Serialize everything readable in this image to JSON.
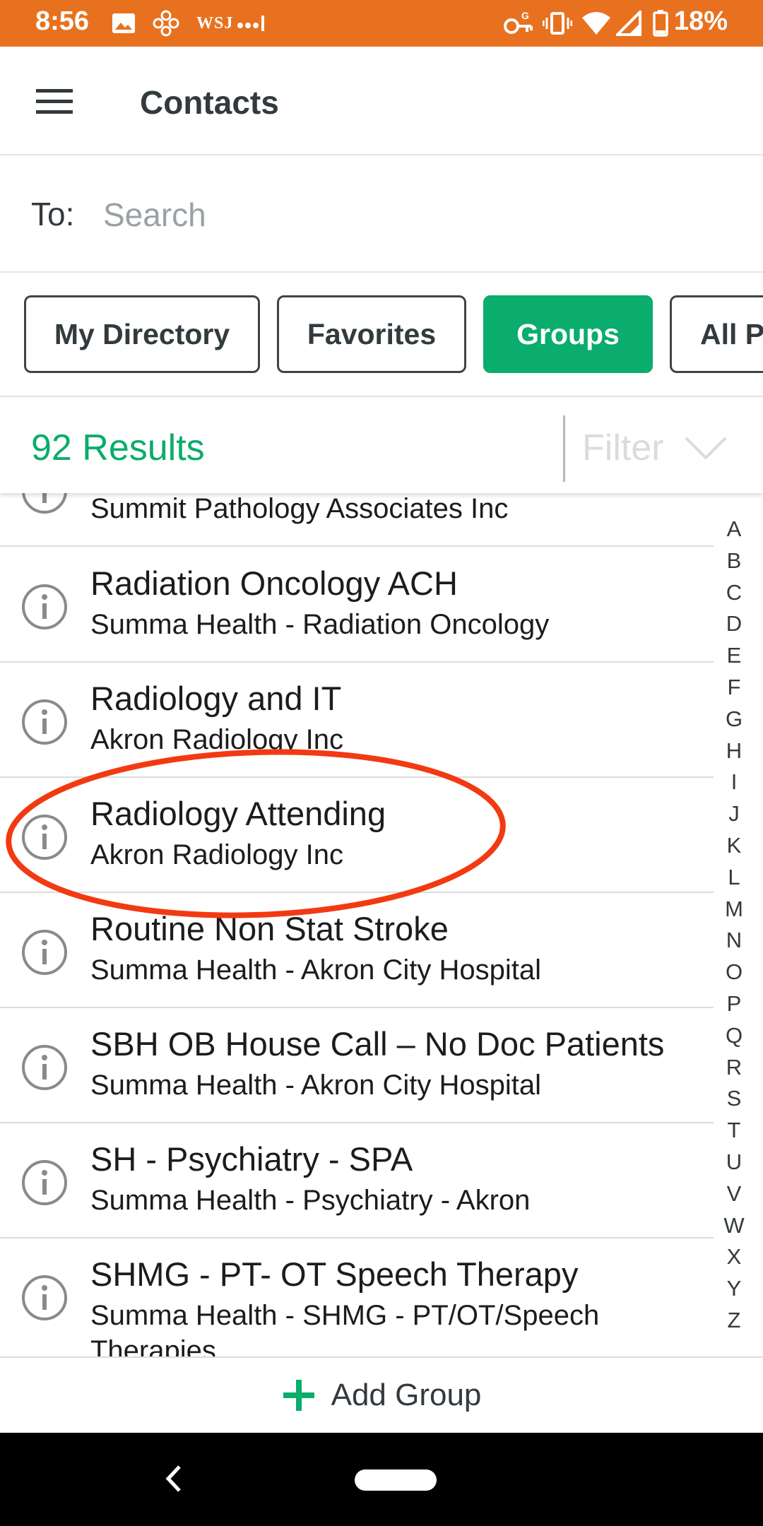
{
  "status_bar": {
    "time": "8:56",
    "wsj_label": "WSJ",
    "battery_percent": "18%",
    "left_icons": [
      "image-icon",
      "pinwheel-icon",
      "wsj-icon",
      "signal-dots-icon"
    ],
    "right_icons": [
      "key-icon",
      "vibrate-icon",
      "wifi-icon",
      "cell-signal-icon",
      "battery-icon"
    ],
    "background_color": "#E8711F"
  },
  "app_bar": {
    "title": "Contacts",
    "menu_icon": "hamburger-menu-icon"
  },
  "search": {
    "label": "To:",
    "placeholder": "Search"
  },
  "tabs": [
    {
      "label": "My Directory",
      "active": false
    },
    {
      "label": "Favorites",
      "active": false
    },
    {
      "label": "Groups",
      "active": true
    },
    {
      "label": "All P",
      "active": false
    }
  ],
  "results": {
    "count_label": "92 Results",
    "filter_label": "Filter",
    "filter_icon": "chevron-down-icon"
  },
  "list": {
    "items": [
      {
        "title": "",
        "subtitle": "Summit Pathology Associates Inc"
      },
      {
        "title": "Radiation Oncology ACH",
        "subtitle": "Summa Health - Radiation Oncology"
      },
      {
        "title": "Radiology and IT",
        "subtitle": "Akron Radiology Inc"
      },
      {
        "title": "Radiology Attending",
        "subtitle": "Akron Radiology Inc",
        "highlighted": true
      },
      {
        "title": "Routine Non Stat Stroke",
        "subtitle": "Summa Health - Akron City Hospital"
      },
      {
        "title": "SBH OB House Call – No Doc Patients",
        "subtitle": "Summa Health - Akron City Hospital"
      },
      {
        "title": "SH - Psychiatry - SPA",
        "subtitle": "Summa Health - Psychiatry - Akron"
      },
      {
        "title": "SHMG - PT- OT Speech Therapy",
        "subtitle": "Summa Health - SHMG - PT/OT/Speech",
        "subtitle_line2": "Therapies"
      }
    ]
  },
  "alphabet_index": [
    "A",
    "B",
    "C",
    "D",
    "E",
    "F",
    "G",
    "H",
    "I",
    "J",
    "K",
    "L",
    "M",
    "N",
    "O",
    "P",
    "Q",
    "R",
    "S",
    "T",
    "U",
    "V",
    "W",
    "X",
    "Y",
    "Z"
  ],
  "add_group": {
    "label": "Add Group",
    "icon": "plus-icon"
  },
  "colors": {
    "accent_green": "#0AAD6B",
    "annotation_red": "#F23A12",
    "status_orange": "#E8711F"
  }
}
